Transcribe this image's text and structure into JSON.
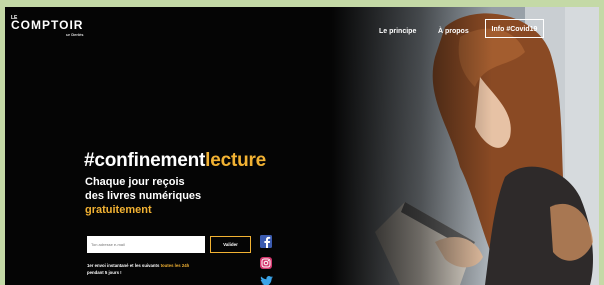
{
  "logo": {
    "top": "LE",
    "main": "COMPTOIR",
    "sub": "ur Deriès"
  },
  "nav": {
    "principe": "Le principe",
    "apropos": "À propos",
    "covid": "Info #Covid19"
  },
  "hero": {
    "headline_part1": "#confinement",
    "headline_part2": "lecture",
    "sub_line1": "Chaque jour reçois",
    "sub_line2": "des livres numériques",
    "sub_line3": "gratuitement"
  },
  "form": {
    "email_placeholder": "Ton adresse e-mail",
    "submit_label": "Valider"
  },
  "note": {
    "part1": "1er envoi instantané et les suivants ",
    "highlight": "toutes les 24h",
    "part2": "pendant 5 jours !"
  },
  "social": [
    "facebook-icon",
    "instagram-icon",
    "twitter-icon"
  ],
  "colors": {
    "accent": "#f2b233",
    "background": "#050505",
    "border": "#c4d9a6"
  }
}
